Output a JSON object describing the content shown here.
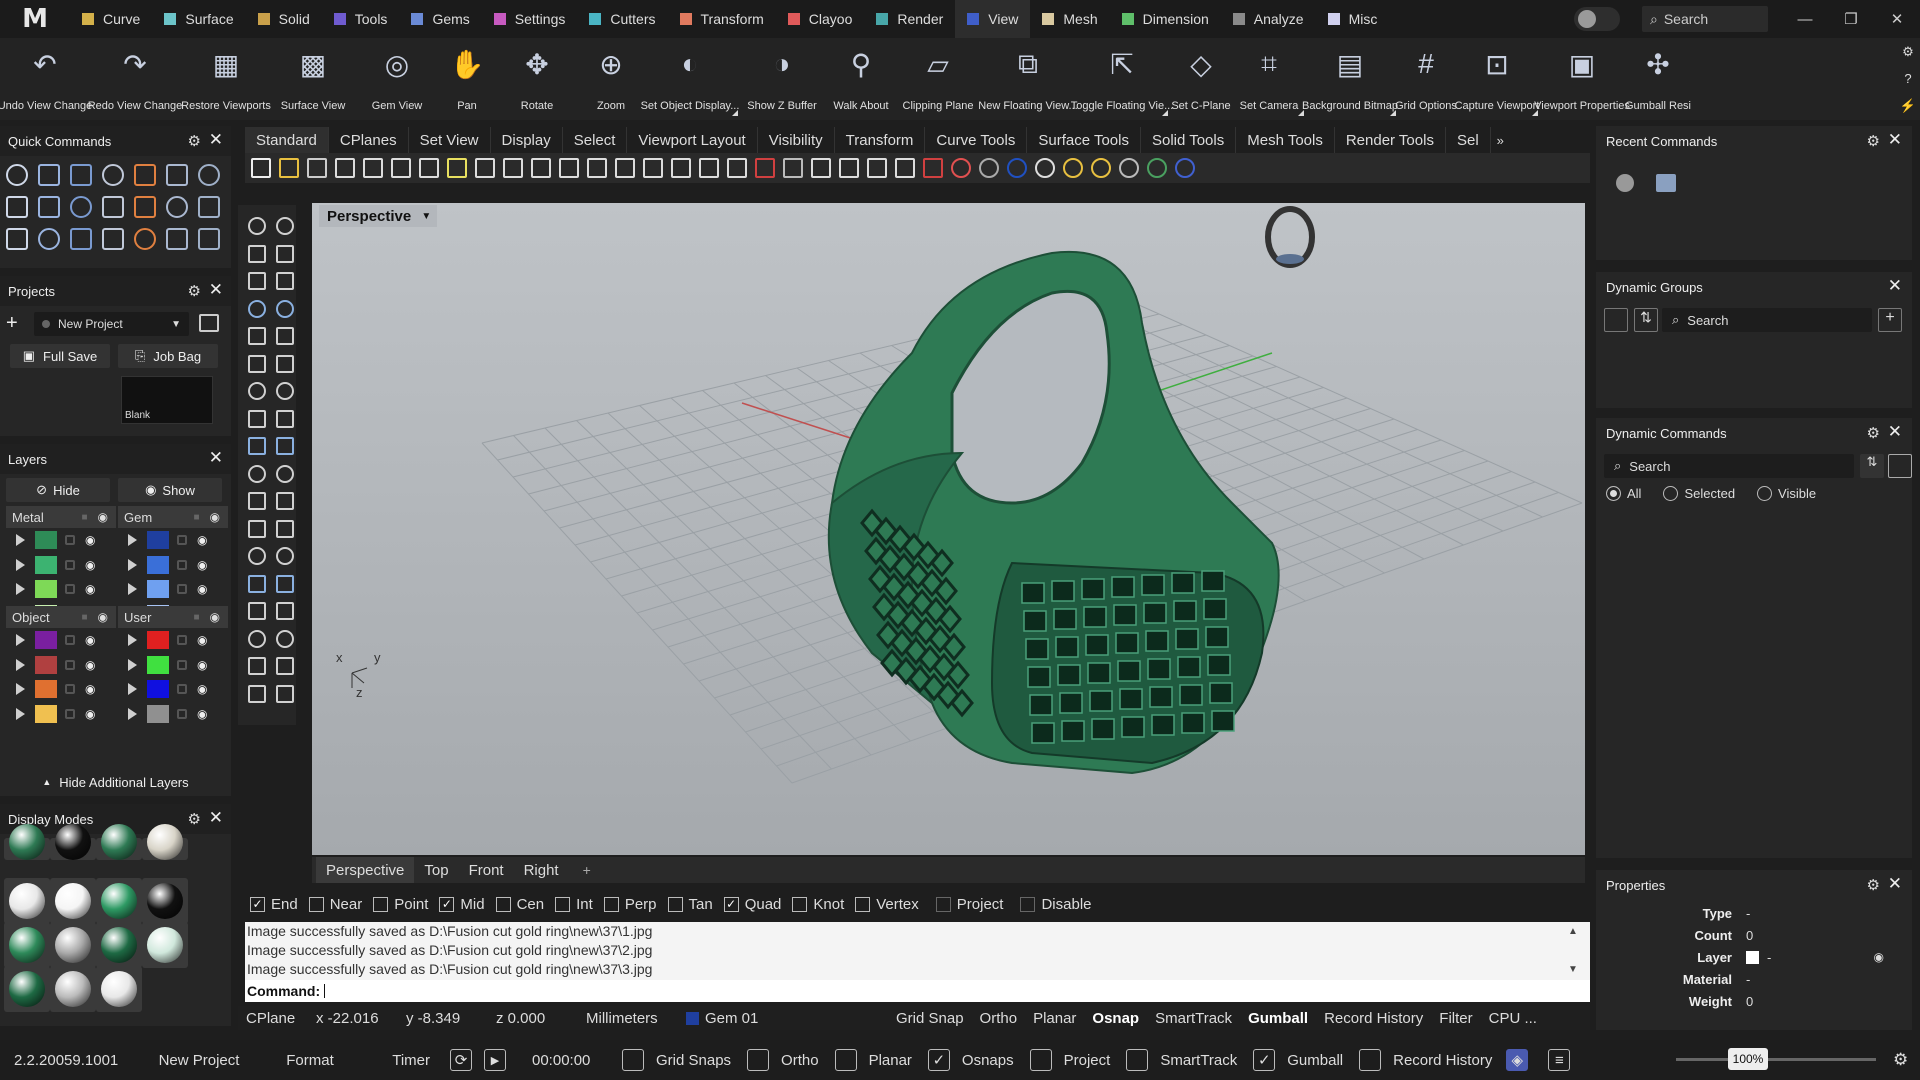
{
  "menu": {
    "tabs": [
      {
        "label": "Curve",
        "color": "#d4b14a"
      },
      {
        "label": "Surface",
        "color": "#6cc4c9"
      },
      {
        "label": "Solid",
        "color": "#c9a04a"
      },
      {
        "label": "Tools",
        "color": "#6f5bd0"
      },
      {
        "label": "Gems",
        "color": "#6a8ad6"
      },
      {
        "label": "Settings",
        "color": "#c75ac0"
      },
      {
        "label": "Cutters",
        "color": "#4ab5c4"
      },
      {
        "label": "Transform",
        "color": "#e07a5f"
      },
      {
        "label": "Clayoo",
        "color": "#e05a5a"
      },
      {
        "label": "Render",
        "color": "#48a7a9"
      },
      {
        "label": "View",
        "color": "#3f5ec9"
      },
      {
        "label": "Mesh",
        "color": "#d9c9a0"
      },
      {
        "label": "Dimension",
        "color": "#5fbf6a"
      },
      {
        "label": "Analyze",
        "color": "#8a8a8a"
      },
      {
        "label": "Misc",
        "color": "#d0d0ee"
      }
    ],
    "active": "View",
    "search_placeholder": "Search"
  },
  "ribbon": [
    {
      "label": "Undo View Change",
      "icon": "undo-view-icon"
    },
    {
      "label": "Redo View Change",
      "icon": "redo-view-icon"
    },
    {
      "label": "Restore Viewports",
      "icon": "restore-viewports-icon"
    },
    {
      "label": "Surface View",
      "icon": "surface-view-icon"
    },
    {
      "label": "Gem View",
      "icon": "gem-view-icon"
    },
    {
      "label": "Pan",
      "icon": "hand-icon"
    },
    {
      "label": "Rotate",
      "icon": "rotate-icon"
    },
    {
      "label": "Zoom",
      "icon": "zoom-icon"
    },
    {
      "label": "Set Object Display...",
      "icon": "object-display-icon"
    },
    {
      "label": "Show Z Buffer",
      "icon": "z-buffer-icon"
    },
    {
      "label": "Walk About",
      "icon": "walk-icon"
    },
    {
      "label": "Clipping Plane",
      "icon": "clipping-plane-icon"
    },
    {
      "label": "New Floating View...",
      "icon": "floating-view-icon"
    },
    {
      "label": "Toggle Floating Vie...",
      "icon": "toggle-floating-icon"
    },
    {
      "label": "Set C-Plane",
      "icon": "cplane-icon"
    },
    {
      "label": "Set Camera",
      "icon": "camera-icon"
    },
    {
      "label": "Background Bitmap",
      "icon": "bitmap-icon"
    },
    {
      "label": "Grid Options",
      "icon": "grid-icon"
    },
    {
      "label": "Capture Viewport",
      "icon": "capture-icon"
    },
    {
      "label": "Viewport Properties",
      "icon": "viewport-props-icon"
    },
    {
      "label": "Gumball Resi",
      "icon": "gumball-icon"
    }
  ],
  "quick_commands": {
    "title": "Quick Commands"
  },
  "projects": {
    "title": "Projects",
    "selected": "New Project",
    "full_save": "Full Save",
    "job_bag": "Job Bag",
    "thumb_label": "Blank"
  },
  "layers": {
    "title": "Layers",
    "hide": "Hide",
    "show": "Show",
    "groups": [
      {
        "name": "Metal",
        "colors": [
          "#2e8b57",
          "#3cb371",
          "#7ed957",
          "#c8f0b0"
        ]
      },
      {
        "name": "Gem",
        "colors": [
          "#1f3f9f",
          "#3a6fd8",
          "#6fa0f0",
          "#a8c4f4"
        ]
      },
      {
        "name": "Object",
        "colors": [
          "#7a1fa0",
          "#b04040",
          "#e07030",
          "#f0c050"
        ]
      },
      {
        "name": "User",
        "colors": [
          "#e02020",
          "#40e040",
          "#1010e0",
          "#909090"
        ]
      }
    ],
    "footer": "Hide Additional Layers"
  },
  "display_modes": {
    "title": "Display Modes"
  },
  "command_tabs": [
    "Standard",
    "CPlanes",
    "Set View",
    "Display",
    "Select",
    "Viewport Layout",
    "Visibility",
    "Transform",
    "Curve Tools",
    "Surface Tools",
    "Solid Tools",
    "Mesh Tools",
    "Render Tools",
    "Sel"
  ],
  "viewport": {
    "name": "Perspective",
    "axis_x": "x",
    "axis_y": "y",
    "axis_z": "z"
  },
  "viewport_tabs": [
    "Perspective",
    "Top",
    "Front",
    "Right"
  ],
  "osnaps": [
    {
      "label": "End",
      "checked": true
    },
    {
      "label": "Near",
      "checked": false
    },
    {
      "label": "Point",
      "checked": false
    },
    {
      "label": "Mid",
      "checked": true
    },
    {
      "label": "Cen",
      "checked": false
    },
    {
      "label": "Int",
      "checked": false
    },
    {
      "label": "Perp",
      "checked": false
    },
    {
      "label": "Tan",
      "checked": false
    },
    {
      "label": "Quad",
      "checked": true
    },
    {
      "label": "Knot",
      "checked": false
    },
    {
      "label": "Vertex",
      "checked": false
    },
    {
      "label": "Project",
      "checked": false,
      "dim": true
    },
    {
      "label": "Disable",
      "checked": false,
      "dim": true
    }
  ],
  "command_history": [
    "Image successfully saved as D:\\Fusion cut gold ring\\new\\37\\1.jpg",
    "Image successfully saved as D:\\Fusion cut gold ring\\new\\37\\2.jpg",
    "Image successfully saved as D:\\Fusion cut gold ring\\new\\37\\3.jpg"
  ],
  "command_prompt": "Command:",
  "status": {
    "cplane": "CPlane",
    "x": "x -22.016",
    "y": "y -8.349",
    "z": "z 0.000",
    "units": "Millimeters",
    "layer": "Gem 01",
    "layer_color": "#1f3f9f",
    "toggles": [
      "Grid Snap",
      "Ortho",
      "Planar",
      "Osnap",
      "SmartTrack",
      "Gumball",
      "Record History",
      "Filter",
      "CPU ..."
    ],
    "bold_toggles": [
      "Osnap",
      "Gumball"
    ]
  },
  "recent_commands": {
    "title": "Recent Commands"
  },
  "dynamic_groups": {
    "title": "Dynamic Groups",
    "search": "Search"
  },
  "dynamic_commands": {
    "title": "Dynamic Commands",
    "search": "Search",
    "radios": [
      "All",
      "Selected",
      "Visible"
    ],
    "selected": "All"
  },
  "properties": {
    "title": "Properties",
    "rows": [
      {
        "k": "Type",
        "v": "-"
      },
      {
        "k": "Count",
        "v": "0"
      },
      {
        "k": "Layer",
        "v": "-"
      },
      {
        "k": "Material",
        "v": "-"
      },
      {
        "k": "Weight",
        "v": "0"
      }
    ]
  },
  "bottom": {
    "version": "2.2.20059.1001",
    "project": "New Project",
    "format": "Format",
    "timer": "Timer",
    "time": "00:00:00",
    "toggles": [
      {
        "label": "Grid Snaps",
        "checked": false
      },
      {
        "label": "Ortho",
        "checked": false
      },
      {
        "label": "Planar",
        "checked": false
      },
      {
        "label": "Osnaps",
        "checked": true
      },
      {
        "label": "Project",
        "checked": false
      },
      {
        "label": "SmartTrack",
        "checked": false
      },
      {
        "label": "Gumball",
        "checked": true
      },
      {
        "label": "Record History",
        "checked": false
      }
    ],
    "zoom": "100%"
  },
  "colors": {
    "ring": "#2f7a55",
    "ring_dark": "#1d4f37",
    "accent_view": "#3f5ec9"
  }
}
